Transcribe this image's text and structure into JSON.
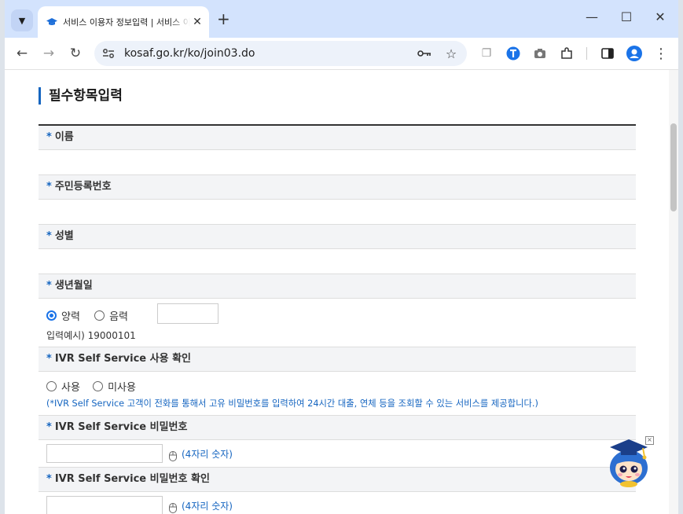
{
  "browser": {
    "tab_title": "서비스 이용자 정보입력 | 서비스 이용자",
    "url": "kosaf.go.kr/ko/join03.do",
    "accent_color": "#1a73e8"
  },
  "page": {
    "section_title": "필수항목입력",
    "star": "*",
    "fields": {
      "name": {
        "label": "이름"
      },
      "rrn": {
        "label": "주민등록번호"
      },
      "gender": {
        "label": "성별"
      },
      "birth": {
        "label": "생년월일",
        "options": [
          "양력",
          "음력"
        ],
        "selected": "양력",
        "value": "",
        "example": "입력예시) 19000101"
      },
      "ivr_use": {
        "label": "IVR Self Service 사용 확인",
        "options": [
          "사용",
          "미사용"
        ],
        "desc_prefix": "(*IVR Self Service",
        "desc_rest": " 고객이 전화를 통해서 고유 비밀번호를 입력하여 24시간 대출, 연체 등을 조회할 수 있는 서비스를 제공합니다.)"
      },
      "ivr_pw": {
        "label": "IVR Self Service 비밀번호",
        "value": "",
        "hint": "(4자리 숫자)"
      },
      "ivr_pw_confirm": {
        "label": "IVR Self Service 비밀번호 확인",
        "value": "",
        "hint": "(4자리 숫자)"
      }
    }
  }
}
